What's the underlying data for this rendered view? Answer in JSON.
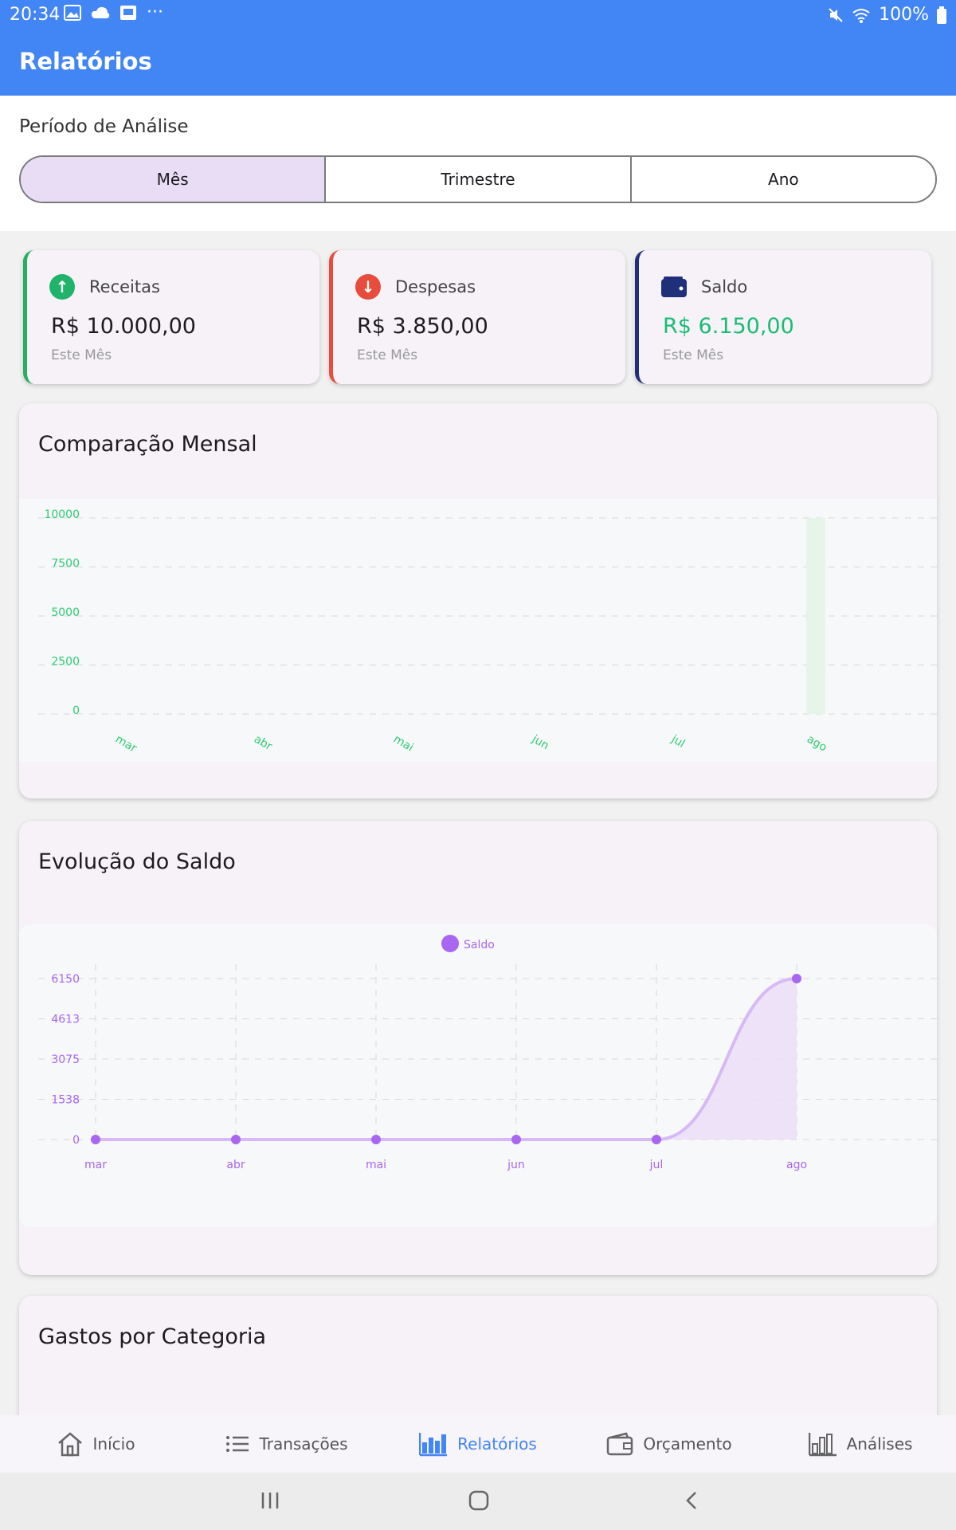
{
  "status_bar": {
    "time": "20:34",
    "battery": "100%"
  },
  "app_bar": {
    "title": "Relatórios"
  },
  "period": {
    "label": "Período de Análise",
    "options": [
      "Mês",
      "Trimestre",
      "Ano"
    ],
    "selected": "Mês"
  },
  "summary": {
    "income": {
      "label": "Receitas",
      "value": "R$ 10.000,00",
      "sub": "Este Mês",
      "color": "#27ae60",
      "icon": "arrow-up-icon"
    },
    "expenses": {
      "label": "Despesas",
      "value": "R$ 3.850,00",
      "sub": "Este Mês",
      "color": "#e74c3c",
      "icon": "arrow-down-icon"
    },
    "balance": {
      "label": "Saldo",
      "value": "R$ 6.150,00",
      "sub": "Este Mês",
      "color": "#1f2f7a",
      "value_color": "#1abc74",
      "icon": "wallet-icon"
    }
  },
  "monthly_comparison": {
    "title": "Comparação Mensal"
  },
  "balance_evolution": {
    "title": "Evolução do Saldo"
  },
  "category_spending": {
    "title": "Gastos por Categoria"
  },
  "chart_data": [
    {
      "type": "bar",
      "title": "Comparação Mensal",
      "categories": [
        "mar",
        "abr",
        "mai",
        "jun",
        "jul",
        "ago"
      ],
      "values": [
        0,
        0,
        0,
        0,
        0,
        10000
      ],
      "yticks": [
        "10000",
        "7500",
        "5000",
        "2500",
        "0"
      ],
      "ylim": [
        0,
        10000
      ],
      "color": "#e6f4ea",
      "tick_color": "#2ecc71",
      "grid": true
    },
    {
      "type": "area",
      "title": "Evolução do Saldo",
      "categories": [
        "mar",
        "abr",
        "mai",
        "jun",
        "jul",
        "ago"
      ],
      "series": [
        {
          "name": "Saldo",
          "values": [
            0,
            0,
            0,
            0,
            0,
            6150
          ]
        }
      ],
      "yticks": [
        "6150",
        "4613",
        "3075",
        "1538",
        "0"
      ],
      "ylim": [
        0,
        6150
      ],
      "color": "#a966f0",
      "fill": "#ebdff7",
      "legend": "top-center",
      "grid": true
    }
  ],
  "bottom_nav": {
    "items": [
      {
        "label": "Início",
        "icon": "home-icon"
      },
      {
        "label": "Transações",
        "icon": "list-icon"
      },
      {
        "label": "Relatórios",
        "icon": "bar-chart-icon"
      },
      {
        "label": "Orçamento",
        "icon": "wallet-icon"
      },
      {
        "label": "Análises",
        "icon": "analytics-icon"
      }
    ],
    "active": "Relatórios"
  }
}
